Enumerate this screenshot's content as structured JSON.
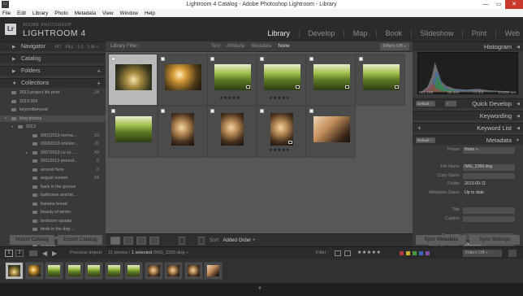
{
  "window": {
    "title": "Lightroom 4 Catalog - Adobe Photoshop Lightroom - Library",
    "app_icon": "Lr",
    "controls": [
      "minimize-icon",
      "maximize-icon",
      "close-icon"
    ],
    "control_glyphs": [
      "—",
      "▭",
      "✕"
    ]
  },
  "menu": [
    "File",
    "Edit",
    "Library",
    "Photo",
    "Metadata",
    "View",
    "Window",
    "Help"
  ],
  "brand": {
    "logo": "Lr",
    "sub": "ADOBE PHOTOSHOP",
    "main": "LIGHTROOM 4"
  },
  "modules": [
    "Library",
    "Develop",
    "Map",
    "Book",
    "Slideshow",
    "Print",
    "Web"
  ],
  "active_module": "Library",
  "module_separator": "|",
  "left": {
    "navigator": {
      "label": "Navigator",
      "options": [
        "FIT",
        "FILL",
        "1:1",
        "1:16 ÷"
      ]
    },
    "catalog": "Catalog",
    "folders": "Folders",
    "collections": "Collections",
    "collection_rows": [
      {
        "label": "2013 project life print",
        "count": "24",
        "indent": 14,
        "icon": true
      },
      {
        "label": "2013-365",
        "count": "",
        "indent": 14,
        "icon": true
      },
      {
        "label": "beyondbeyond",
        "count": "",
        "indent": 14,
        "icon": true
      },
      {
        "label": "blog photos",
        "count": "",
        "indent": 14,
        "icon": true,
        "tri": "▾"
      },
      {
        "label": "2013",
        "count": "",
        "indent": 22,
        "icon": true,
        "tri": "▾"
      },
      {
        "label": "09012013 norma...",
        "count": "53",
        "indent": 40,
        "icon": true
      },
      {
        "label": "09062013 snicker...",
        "count": "20",
        "indent": 40,
        "icon": true
      },
      {
        "label": "09072013 cu vs. ...",
        "count": "43",
        "indent": 40,
        "icon": true,
        "tri": "▸"
      },
      {
        "label": "09112013 around...",
        "count": "8",
        "indent": 40,
        "icon": true
      },
      {
        "label": "around here",
        "count": "8",
        "indent": 40,
        "icon": true
      },
      {
        "label": "august sunset",
        "count": "54",
        "indent": 40,
        "icon": true
      },
      {
        "label": "back in the groove",
        "count": "",
        "indent": 40,
        "icon": true
      },
      {
        "label": "bathroom and be...",
        "count": "",
        "indent": 40,
        "icon": true
      },
      {
        "label": "banana bread",
        "count": "",
        "indent": 40,
        "icon": true
      },
      {
        "label": "beauty of winter",
        "count": "",
        "indent": 40,
        "icon": true
      },
      {
        "label": "bedroom update",
        "count": "",
        "indent": 40,
        "icon": true
      },
      {
        "label": "birds in the dog ...",
        "count": "",
        "indent": 40,
        "icon": true
      },
      {
        "label": "blog about nothi...",
        "count": "",
        "indent": 40,
        "icon": true
      },
      {
        "label": "bubbles",
        "count": "",
        "indent": 40,
        "icon": true
      }
    ],
    "import_button": "Import Catalog",
    "export_button": "Export Catalog"
  },
  "library_filter": {
    "label": "Library Filter :",
    "options": [
      "Text",
      "Attribute",
      "Metadata",
      "None"
    ],
    "active": "None",
    "filters_off": "Filters Off ÷"
  },
  "grid": [
    {
      "selected": true,
      "palette": "sunset",
      "stars": "",
      "badge": false
    },
    {
      "selected": false,
      "palette": "sun",
      "stars": "",
      "badge": false
    },
    {
      "selected": false,
      "palette": "tree",
      "stars": "★★★★★",
      "badge": true
    },
    {
      "selected": false,
      "palette": "tree",
      "stars": "★★★★★",
      "badge": true
    },
    {
      "selected": false,
      "palette": "tree",
      "stars": "",
      "badge": true
    },
    {
      "selected": false,
      "palette": "tree",
      "stars": "",
      "badge": true
    },
    {
      "selected": false,
      "palette": "tree",
      "stars": "",
      "badge": false
    },
    {
      "selected": false,
      "palette": "candle",
      "stars": "",
      "badge": false
    },
    {
      "selected": false,
      "palette": "candle",
      "stars": "",
      "badge": false
    },
    {
      "selected": false,
      "palette": "candle",
      "stars": "★★★★★",
      "badge": true
    },
    {
      "selected": false,
      "palette": "window",
      "stars": "",
      "badge": false
    }
  ],
  "toolbar": {
    "sort_label": "Sort:",
    "sort_value": "Added Order ÷",
    "view_icons": [
      "grid-view-icon",
      "loupe-view-icon",
      "compare-view-icon",
      "survey-view-icon"
    ],
    "painter_icon": "spray-can-icon",
    "sort_direction_icon": "sort-direction-icon"
  },
  "right": {
    "histogram": "Histogram",
    "exif": [
      "ISO 100",
      "50 mm",
      "f / 3.2",
      "1/1250 sec"
    ],
    "quick_develop": "Quick Develop",
    "qd_preset": "Default ÷",
    "qd_select": "÷",
    "keywording": "Keywording",
    "keyword_list": "Keyword List",
    "metadata": "Metadata",
    "md_preset": "Default ÷",
    "rows": [
      {
        "k": "Preset",
        "v": "None ÷",
        "box": true
      },
      {
        "k": "",
        "v": "",
        "box": false
      },
      {
        "k": "File Name",
        "v": "IMG_2360.dng",
        "box": true
      },
      {
        "k": "Copy Name",
        "v": "",
        "box": true
      },
      {
        "k": "Folder",
        "v": "2013-09-11",
        "box": true
      },
      {
        "k": "Metadata Status",
        "v": "Up to date",
        "box": true
      },
      {
        "k": "",
        "v": "",
        "box": false
      },
      {
        "k": "Title",
        "v": "",
        "box": true
      },
      {
        "k": "Caption",
        "v": "",
        "box": true
      },
      {
        "k": "",
        "v": "",
        "box": false
      },
      {
        "k": "Copyright",
        "v": "",
        "box": true
      },
      {
        "k": "Copyright Status",
        "v": "Unknown ÷",
        "box": true
      }
    ],
    "sync_metadata": "Sync Metadata",
    "sync_settings": "Sync Settings"
  },
  "filmbar": {
    "previous_import": "Previous Import",
    "count": "11 photos / ",
    "selected": "1 selected",
    "path": " /IMG_2360.dng ÷",
    "filter_label": "Filter :",
    "stars": "★★★★★",
    "filters_off": "Filters Off ÷",
    "colors": [
      "#b23a3a",
      "#c9b431",
      "#4b9a43",
      "#3b62b3",
      "#8a4aa8"
    ],
    "page_buttons": [
      "1",
      "2"
    ]
  },
  "filmstrip": [
    {
      "selected": true,
      "palette": "sunset"
    },
    {
      "selected": false,
      "palette": "sun"
    },
    {
      "selected": false,
      "palette": "tree"
    },
    {
      "selected": false,
      "palette": "tree"
    },
    {
      "selected": false,
      "palette": "tree"
    },
    {
      "selected": false,
      "palette": "tree"
    },
    {
      "selected": false,
      "palette": "tree"
    },
    {
      "selected": false,
      "palette": "candle"
    },
    {
      "selected": false,
      "palette": "candle"
    },
    {
      "selected": false,
      "palette": "candle"
    },
    {
      "selected": false,
      "palette": "window"
    }
  ],
  "colors": {
    "panel_bg": "#393939",
    "grid_bg": "#575757",
    "selected_cell": "#b9b9b9",
    "active_module": "#e8e8e8"
  }
}
